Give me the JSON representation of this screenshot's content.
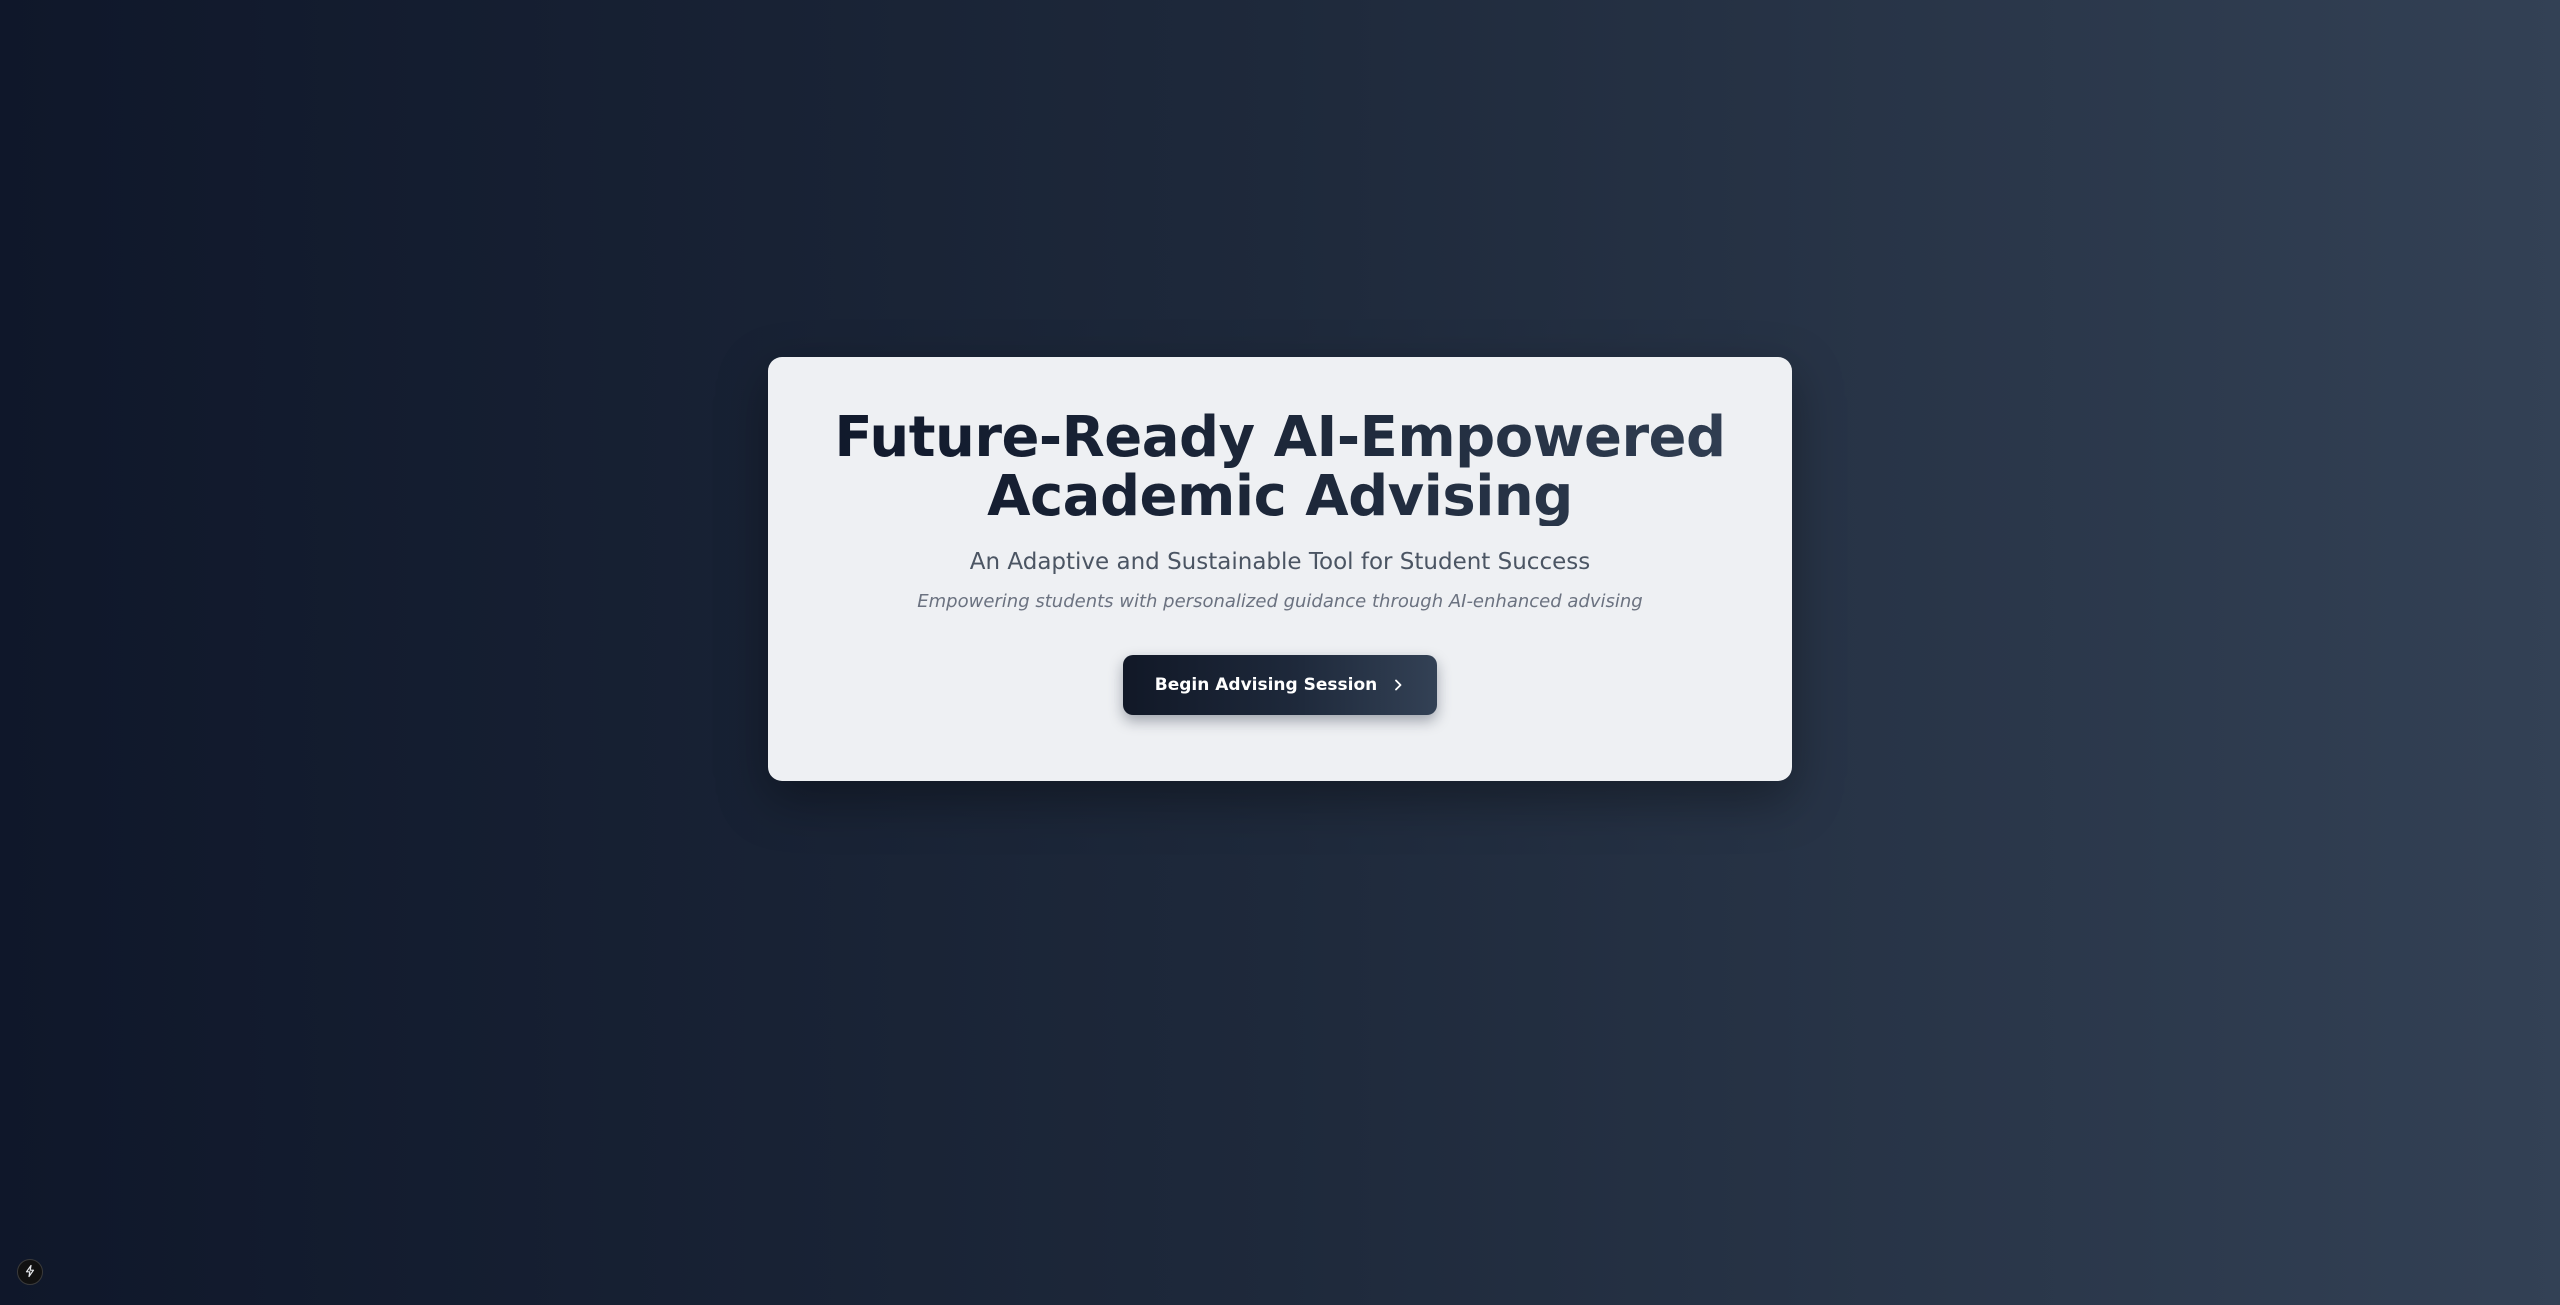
{
  "hero": {
    "title_line1": "Future-Ready AI-Empowered",
    "title_line2": "Academic Advising",
    "subtitle": "An Adaptive and Sustainable Tool for Student Success",
    "tagline": "Empowering students with personalized guidance through AI-enhanced advising",
    "cta_label": "Begin Advising Session"
  },
  "icons": {
    "cta": "chevron-right-icon",
    "dev_badge": "lightning-icon"
  },
  "colors": {
    "background_start": "#0f172a",
    "background_end": "#334155",
    "card": "#eef0f3",
    "title": "#1e293b",
    "subtitle": "#4b5563",
    "tagline": "#6b7280"
  }
}
